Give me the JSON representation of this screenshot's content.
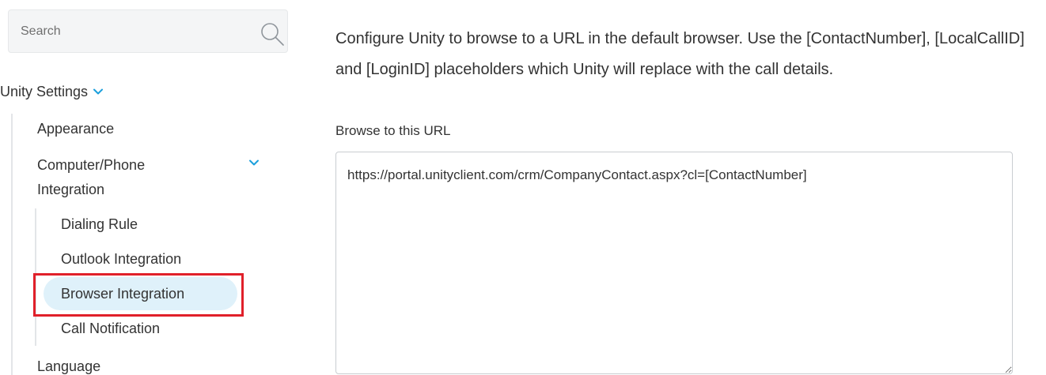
{
  "search": {
    "placeholder": "Search"
  },
  "sidebar": {
    "section_title": "Unity Settings",
    "items": [
      {
        "label": "Appearance"
      },
      {
        "label": "Computer/Phone Integration"
      },
      {
        "label": "Language"
      }
    ],
    "cti_children": [
      {
        "label": "Dialing Rule"
      },
      {
        "label": "Outlook Integration"
      },
      {
        "label": "Browser Integration",
        "active": true
      },
      {
        "label": "Call Notification"
      }
    ]
  },
  "main": {
    "description": "Configure Unity to browse to a URL in the default browser. Use the [ContactNumber], [LocalCallID] and [LoginID] placeholders which Unity will replace with the call details.",
    "url_label": "Browse to this URL",
    "url_value": "https://portal.unityclient.com/crm/CompanyContact.aspx?cl=[ContactNumber]"
  },
  "colors": {
    "accent": "#1a9fdc",
    "active_bg": "#dff1fa",
    "highlight": "#e0202a"
  }
}
